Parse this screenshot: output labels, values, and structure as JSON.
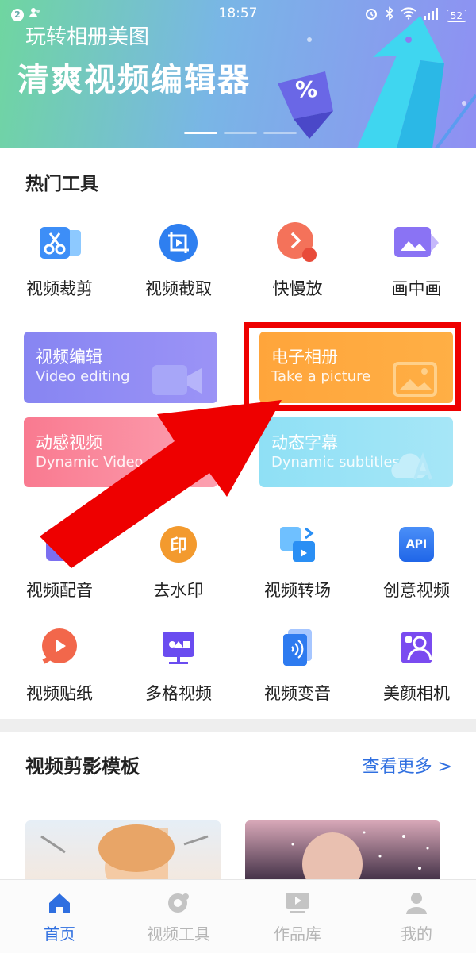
{
  "status": {
    "notif_count": "2",
    "time": "18:57",
    "battery": "52"
  },
  "banner": {
    "subtitle": "玩转相册美图",
    "title": "清爽视频编辑器",
    "art_glyph": "%"
  },
  "hot_tools": {
    "title": "热门工具",
    "row1": [
      {
        "label": "视频裁剪",
        "icon": "scissors-icon"
      },
      {
        "label": "视频截取",
        "icon": "crop-icon"
      },
      {
        "label": "快慢放",
        "icon": "speed-icon"
      },
      {
        "label": "画中画",
        "icon": "picture-in-picture-icon"
      }
    ],
    "cards": [
      {
        "title": "视频编辑",
        "subtitle": "Video editing",
        "color": "#8b85f0"
      },
      {
        "title": "电子相册",
        "subtitle": "Take a picture",
        "color": "#ffa63a"
      },
      {
        "title": "动感视频",
        "subtitle": "Dynamic Video",
        "color": "#f98aa0"
      },
      {
        "title": "动态字幕",
        "subtitle": "Dynamic subtitles",
        "color": "#7fd7f3"
      }
    ],
    "row2": [
      {
        "label": "视频配音",
        "icon": "dubbing-icon"
      },
      {
        "label": "去水印",
        "icon": "watermark-icon",
        "glyph": "印"
      },
      {
        "label": "视频转场",
        "icon": "transition-icon"
      },
      {
        "label": "创意视频",
        "icon": "api-icon",
        "glyph": "API"
      }
    ],
    "row3": [
      {
        "label": "视频贴纸",
        "icon": "sticker-icon"
      },
      {
        "label": "多格视频",
        "icon": "grid-video-icon"
      },
      {
        "label": "视频变音",
        "icon": "voice-change-icon"
      },
      {
        "label": "美颜相机",
        "icon": "beauty-camera-icon"
      }
    ]
  },
  "templates": {
    "title": "视频剪影模板",
    "more": "查看更多 >"
  },
  "nav": [
    {
      "label": "首页",
      "icon": "home-icon",
      "active": true
    },
    {
      "label": "视频工具",
      "icon": "tools-icon",
      "active": false
    },
    {
      "label": "作品库",
      "icon": "library-icon",
      "active": false
    },
    {
      "label": "我的",
      "icon": "profile-icon",
      "active": false
    }
  ],
  "colors": {
    "accent": "#2f6fe0",
    "highlight": "#ee0000"
  }
}
